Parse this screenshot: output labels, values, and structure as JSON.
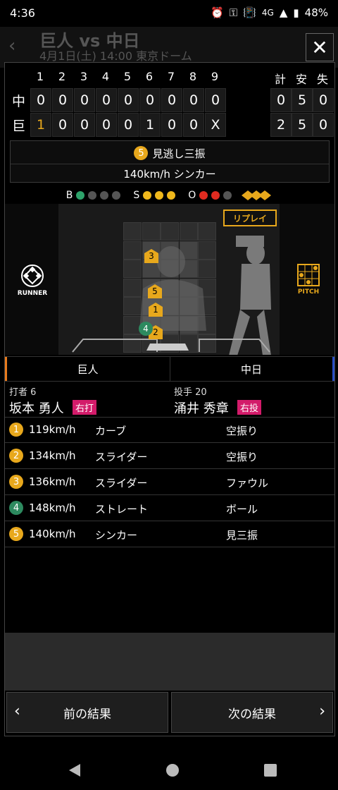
{
  "status": {
    "time": "4:36",
    "network": "4G",
    "battery": "48%"
  },
  "background_header": {
    "title": "巨人 vs 中日",
    "subtitle": "4月1日(土) 14:00 東京ドーム"
  },
  "scoreboard": {
    "innings": [
      "1",
      "2",
      "3",
      "4",
      "5",
      "6",
      "7",
      "8",
      "9"
    ],
    "totals_headers": [
      "計",
      "安",
      "失"
    ],
    "rows": [
      {
        "team": "中",
        "scores": [
          "0",
          "0",
          "0",
          "0",
          "0",
          "0",
          "0",
          "0",
          "0"
        ],
        "totals": [
          "0",
          "5",
          "0"
        ]
      },
      {
        "team": "巨",
        "scores": [
          "1",
          "0",
          "0",
          "0",
          "0",
          "1",
          "0",
          "0",
          "X"
        ],
        "totals": [
          "2",
          "5",
          "0"
        ]
      }
    ]
  },
  "current_pitch": {
    "number": "5",
    "result": "見逃し三振",
    "speed_type": "140km/h シンカー"
  },
  "count": {
    "b_label": "B",
    "s_label": "S",
    "o_label": "O",
    "balls": 1,
    "strikes": 3,
    "outs": 2
  },
  "field": {
    "runner_label": "RUNNER",
    "pitch_label": "PITCH",
    "replay_label": "リプレイ"
  },
  "teams": {
    "home": "巨人",
    "away": "中日"
  },
  "batter": {
    "role": "打者 6",
    "name": "坂本 勇人",
    "hand": "右打"
  },
  "pitcher": {
    "role": "投手 20",
    "name": "涌井 秀章",
    "hand": "右投"
  },
  "pitches": [
    {
      "num": "1",
      "speed": "119km/h",
      "type": "カーブ",
      "result": "空振り",
      "color": "#e8a81c"
    },
    {
      "num": "2",
      "speed": "134km/h",
      "type": "スライダー",
      "result": "空振り",
      "color": "#e8a81c"
    },
    {
      "num": "3",
      "speed": "136km/h",
      "type": "スライダー",
      "result": "ファウル",
      "color": "#e8a81c"
    },
    {
      "num": "4",
      "speed": "148km/h",
      "type": "ストレート",
      "result": "ボール",
      "color": "#2d8a5f"
    },
    {
      "num": "5",
      "speed": "140km/h",
      "type": "シンカー",
      "result": "見三振",
      "color": "#e8a81c"
    }
  ],
  "nav": {
    "prev": "前の結果",
    "next": "次の結果"
  }
}
